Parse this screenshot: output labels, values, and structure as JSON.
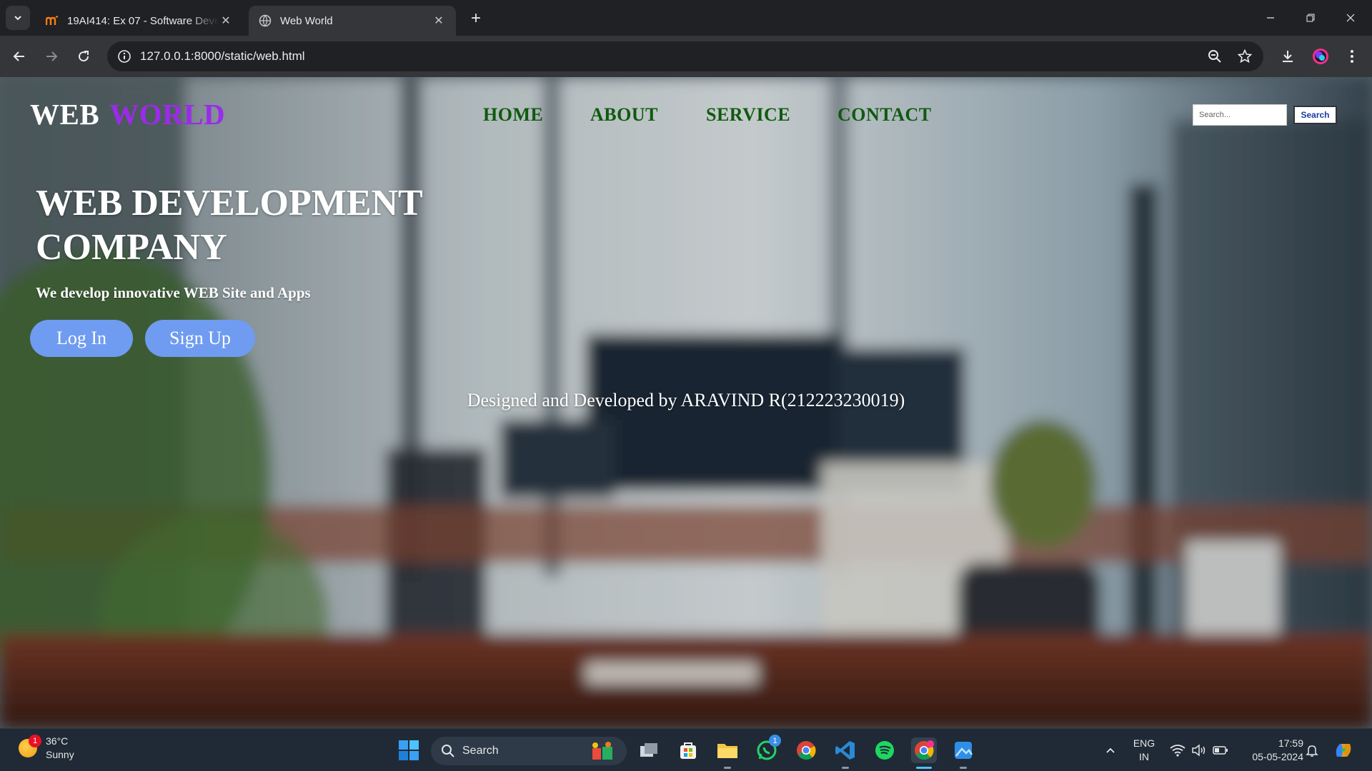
{
  "browser": {
    "tabs": [
      {
        "title": "19AI414: Ex 07 - Software Deve",
        "active": false
      },
      {
        "title": "Web World",
        "active": true
      }
    ],
    "url": "127.0.0.1:8000/static/web.html"
  },
  "page": {
    "logo": {
      "part1": "WEB",
      "part2": "WORLD"
    },
    "nav": [
      "HOME",
      "ABOUT",
      "SERVICE",
      "CONTACT"
    ],
    "search": {
      "placeholder": "Search...",
      "button": "Search"
    },
    "hero": {
      "title": "WEB DEVELOPMENT COMPANY",
      "subtitle": "We develop innovative WEB Site and Apps",
      "login": "Log In",
      "signup": "Sign Up"
    },
    "credit": "Designed and Developed by ARAVIND R(212223230019)"
  },
  "taskbar": {
    "weather": {
      "temp": "36°C",
      "condition": "Sunny",
      "badge": "1"
    },
    "search_label": "Search",
    "whatsapp_badge": "1",
    "language": {
      "line1": "ENG",
      "line2": "IN"
    },
    "time": "17:59",
    "date": "05-05-2024"
  },
  "colors": {
    "logo_accent": "#9b2bea",
    "nav": "#0f5a0f",
    "button": "#6f9cf0"
  }
}
